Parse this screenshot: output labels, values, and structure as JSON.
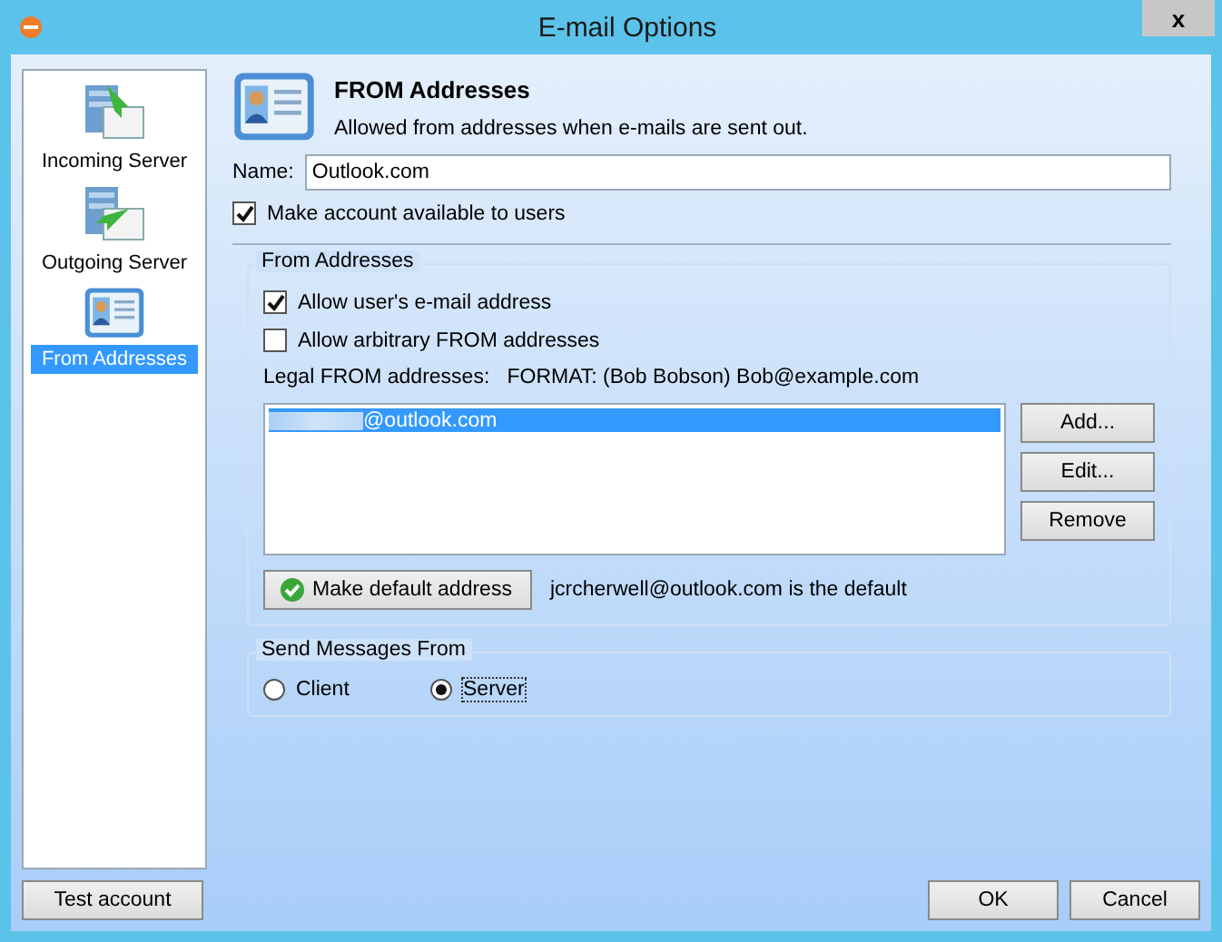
{
  "window": {
    "title": "E-mail Options",
    "close_label": "x"
  },
  "sidebar": {
    "items": [
      {
        "label": "Incoming Server",
        "kind": "incoming",
        "selected": false
      },
      {
        "label": "Outgoing Server",
        "kind": "outgoing",
        "selected": false
      },
      {
        "label": "From Addresses",
        "kind": "card",
        "selected": true
      }
    ]
  },
  "header": {
    "title": "FROM Addresses",
    "subtitle": "Allowed from addresses when e-mails are sent out."
  },
  "name_field": {
    "label": "Name:",
    "value": "Outlook.com"
  },
  "make_available": {
    "label": "Make account available to users",
    "checked": true
  },
  "from_group": {
    "title": "From Addresses",
    "options": [
      {
        "label": "Allow user's e-mail address",
        "checked": true
      },
      {
        "label": "Allow arbitrary FROM addresses",
        "checked": false
      }
    ],
    "list_label": "Legal FROM addresses:   FORMAT: (Bob Bobson) Bob@example.com",
    "addresses": [
      {
        "text": "@outlook.com",
        "redacted": true,
        "selected": true
      }
    ],
    "buttons": [
      "Add...",
      "Edit...",
      "Remove"
    ],
    "default_button": "Make default address",
    "default_note": "jcrcherwell@outlook.com is the default"
  },
  "send_group": {
    "title": "Send Messages From",
    "options": [
      {
        "label": "Client",
        "selected": false
      },
      {
        "label": "Server",
        "selected": true
      }
    ]
  },
  "footer": {
    "test_button": "Test account",
    "buttons": [
      "OK",
      "Cancel"
    ]
  }
}
